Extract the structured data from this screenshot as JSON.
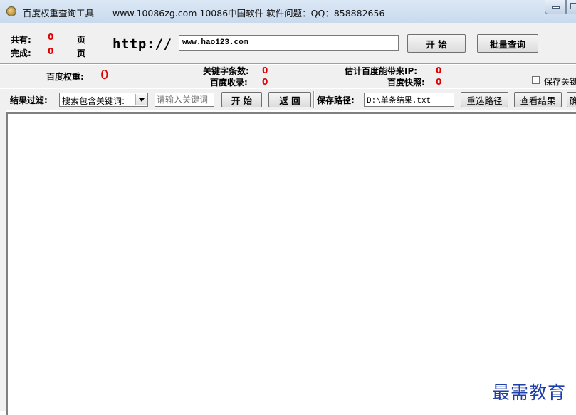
{
  "window": {
    "title": "百度权重查询工具",
    "info": "www.10086zg.com 10086中国软件  软件问题：QQ：858882656"
  },
  "stats": {
    "total_label": "共有:",
    "total_value": "0",
    "total_unit": "页",
    "done_label": "完成:",
    "done_value": "0",
    "done_unit": "页"
  },
  "url_bar": {
    "prefix": "http://",
    "value": "www.hao123.com",
    "start_label": "开 始",
    "batch_label": "批量查询"
  },
  "metrics": {
    "weight_label": "百度权重:",
    "weight_value": "0",
    "keyword_count_label": "关键字条数:",
    "keyword_count_value": "0",
    "indexed_label": "百度收录:",
    "indexed_value": "0",
    "traffic_label": "估计百度能带来IP:",
    "traffic_value": "0",
    "snapshot_label": "百度快照:",
    "snapshot_value": "0",
    "save_keywords_label": "保存关键"
  },
  "filter": {
    "label": "结果过滤:",
    "mode_selected": "搜索包含关键词:",
    "keyword_placeholder": "请输入关键词",
    "start_label": "开 始",
    "back_label": "返 回",
    "save_path_label": "保存路径:",
    "save_path_value": "D:\\单条结果.txt",
    "reselect_label": "重选路径",
    "view_label": "查看结果",
    "cut_label": "确"
  },
  "watermark": "最需教育"
}
